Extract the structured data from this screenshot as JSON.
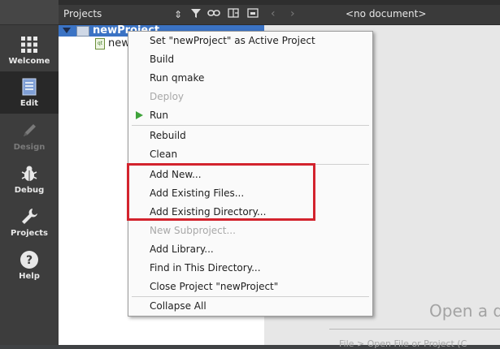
{
  "modes": [
    {
      "key": "welcome",
      "label": "Welcome",
      "icon": "grid-icon",
      "active": false,
      "enabled": true
    },
    {
      "key": "edit",
      "label": "Edit",
      "icon": "document-icon",
      "active": true,
      "enabled": true
    },
    {
      "key": "design",
      "label": "Design",
      "icon": "pencil-icon",
      "active": false,
      "enabled": false
    },
    {
      "key": "debug",
      "label": "Debug",
      "icon": "bug-icon",
      "active": false,
      "enabled": true
    },
    {
      "key": "projects",
      "label": "Projects",
      "icon": "wrench-icon",
      "active": false,
      "enabled": true
    },
    {
      "key": "help",
      "label": "Help",
      "icon": "question-icon",
      "active": false,
      "enabled": true
    }
  ],
  "projects_panel": {
    "title": "Projects",
    "tree": {
      "root": "newProject",
      "child": "new"
    }
  },
  "editor": {
    "document_label": "<no document>",
    "welcome_text": "Open a d",
    "hint_text": "File > Open File or Project (C"
  },
  "context_menu": {
    "items": [
      {
        "label": "Set \"newProject\" as Active Project",
        "enabled": true
      },
      {
        "label": "Build",
        "enabled": true
      },
      {
        "label": "Run qmake",
        "enabled": true
      },
      {
        "label": "Deploy",
        "enabled": false
      },
      {
        "label": "Run",
        "enabled": true,
        "icon": "play-icon"
      },
      {
        "label": "Rebuild",
        "enabled": true
      },
      {
        "label": "Clean",
        "enabled": true
      },
      {
        "label": "Add New...",
        "enabled": true
      },
      {
        "label": "Add Existing Files...",
        "enabled": true
      },
      {
        "label": "Add Existing Directory...",
        "enabled": true
      },
      {
        "label": "New Subproject...",
        "enabled": false
      },
      {
        "label": "Add Library...",
        "enabled": true
      },
      {
        "label": "Find in This Directory...",
        "enabled": true
      },
      {
        "label": "Close Project \"newProject\"",
        "enabled": true
      },
      {
        "label": "Collapse All",
        "enabled": true
      }
    ]
  },
  "colors": {
    "accent": "#3b73c4",
    "highlight_box": "#d3232d",
    "run_green": "#3ea33a"
  }
}
